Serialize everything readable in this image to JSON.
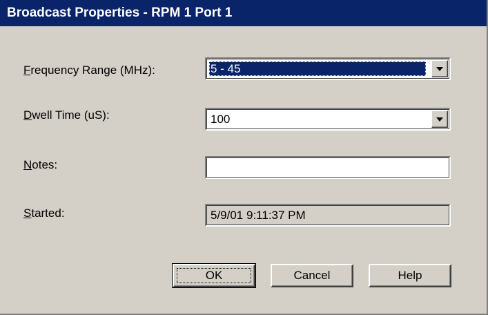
{
  "dialog": {
    "title": "Broadcast Properties - RPM 1 Port 1"
  },
  "fields": {
    "frequency": {
      "label_accel": "F",
      "label_rest": "requency Range (MHz):",
      "value": "5 - 45"
    },
    "dwell": {
      "label_accel": "D",
      "label_rest": "well Time (uS):",
      "value": "100"
    },
    "notes": {
      "label_accel": "N",
      "label_rest": "otes:",
      "value": ""
    },
    "started": {
      "label_accel": "S",
      "label_rest": "tarted:",
      "value": "5/9/01 9:11:37 PM"
    }
  },
  "buttons": {
    "ok": "OK",
    "cancel": "Cancel",
    "help": "Help"
  }
}
